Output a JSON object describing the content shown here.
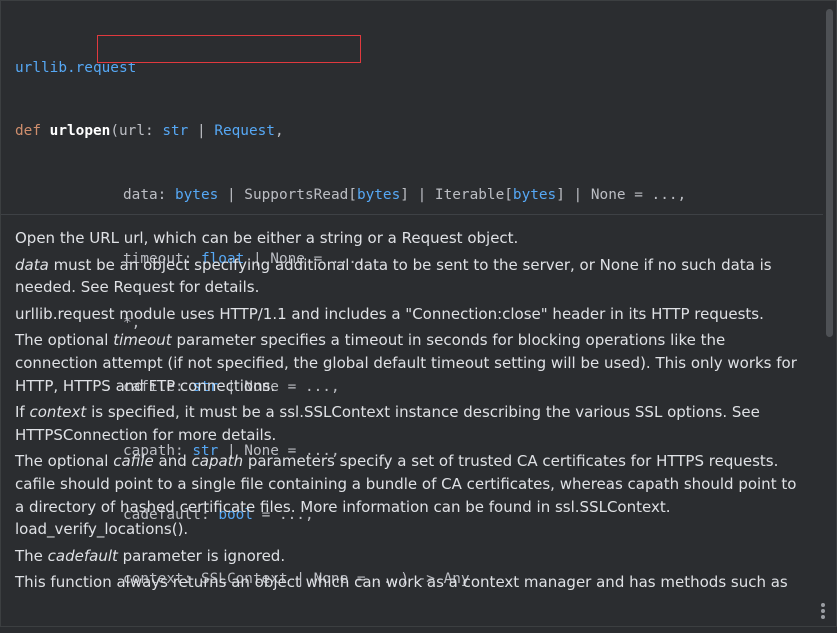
{
  "signature": {
    "module": "urllib.request",
    "line1": {
      "def": "def",
      "name": "urlopen",
      "open": "(url: ",
      "t1": "str",
      "sep": " | ",
      "t2": "Request",
      "end": ","
    },
    "line2": {
      "a": "data: ",
      "t1": "bytes",
      "b": " | SupportsRead[",
      "t2": "bytes",
      "c": "] | Iterable[",
      "t3": "bytes",
      "d": "] | None = ...,"
    },
    "line3": {
      "a": "timeout: ",
      "t1": "float",
      "b": " | None = ...,"
    },
    "line4": {
      "a": "*,"
    },
    "line5": {
      "a": "cafile: ",
      "t1": "str",
      "b": " | None = ...,"
    },
    "line6": {
      "a": "capath: ",
      "t1": "str",
      "b": " | None = ...,"
    },
    "line7": {
      "a": "cadefault: ",
      "t1": "bool",
      "b": " = ...,"
    },
    "line8": {
      "a": "context: SSLContext | None = ...) -> Any"
    }
  },
  "doc": {
    "p1": "Open the URL url, which can be either a string or a Request object.",
    "p2_em": "data",
    "p2": " must be an object specifying additional data to be sent to the server, or None if no such data is needed. See Request for details.",
    "p3": "urllib.request module uses HTTP/1.1 and includes a \"Connection:close\" header in its HTTP requests.",
    "p4_a": "The optional ",
    "p4_em": "timeout",
    "p4_b": " parameter specifies a timeout in seconds for blocking operations like the connection attempt (if not specified, the global default timeout setting will be used). This only works for HTTP, HTTPS and FTP connections.",
    "p5_a": "If ",
    "p5_em": "context",
    "p5_b": " is specified, it must be a ssl.SSLContext instance describing the various SSL options. See HTTPSConnection for more details.",
    "p6_a": "The optional ",
    "p6_em1": "cafile",
    "p6_mid": " and ",
    "p6_em2": "capath",
    "p6_b": " parameters specify a set of trusted CA certificates for HTTPS requests. cafile should point to a single file containing a bundle of CA certificates, whereas capath should point to a directory of hashed certificate files. More information can be found in ssl.SSLContext. load_verify_locations().",
    "p7_a": "The ",
    "p7_em": "cadefault",
    "p7_b": " parameter is ignored.",
    "p8": "This function always returns an object which can work as a context manager and has methods such as"
  },
  "icons": {
    "more": "more-vertical-icon"
  }
}
